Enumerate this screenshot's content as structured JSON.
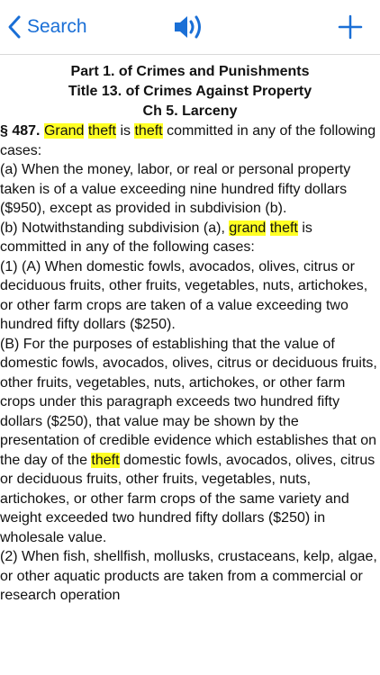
{
  "nav": {
    "back_label": "Search",
    "back_icon": "chevron-left-icon",
    "speaker_icon": "speaker-icon",
    "add_icon": "plus-icon",
    "accent_color": "#1a6fd6"
  },
  "heading": {
    "part": "Part 1. of Crimes and Punishments",
    "title": "Title 13. of Crimes Against Property",
    "chapter": "Ch 5. Larceny"
  },
  "highlight_color": "#ffff24",
  "section": {
    "number": "§ 487.",
    "w_grand": "Grand",
    "w_theft1": "theft",
    "w_is": "is",
    "w_theft2": "theft",
    "rest": "committed in any of the following cases:"
  },
  "para_a": "(a) When the money, labor, or real or personal property taken is of a value exceeding nine hundred fifty dollars ($950), except as provided in subdivision (b).",
  "para_b": {
    "lead": "(b) Notwithstanding subdivision (a),",
    "w_grand": "grand",
    "w_theft": "theft",
    "rest": "is committed in any of the following cases:"
  },
  "para_b1A": "(1) (A) When domestic fowls, avocados, olives, citrus or deciduous fruits, other fruits, vegetables, nuts, artichokes, or other farm crops are taken of a value exceeding two hundred fifty dollars ($250).",
  "para_b1B": {
    "lead": "(B) For the purposes of establishing that the value of domestic fowls, avocados, olives, citrus or deciduous fruits, other fruits, vegetables, nuts, artichokes, or other farm crops under this paragraph exceeds two hundred fifty dollars ($250), that value may be shown by the presentation of credible evidence which establishes that on the day of the",
    "w_theft": "theft",
    "rest": "domestic fowls, avocados, olives, citrus or deciduous fruits, other fruits, vegetables, nuts, artichokes, or other farm crops of the same variety and weight exceeded two hundred fifty dollars ($250) in wholesale value."
  },
  "para_b2": "(2) When fish, shellfish, mollusks, crustaceans, kelp, algae, or other aquatic products are taken from a commercial or research operation"
}
